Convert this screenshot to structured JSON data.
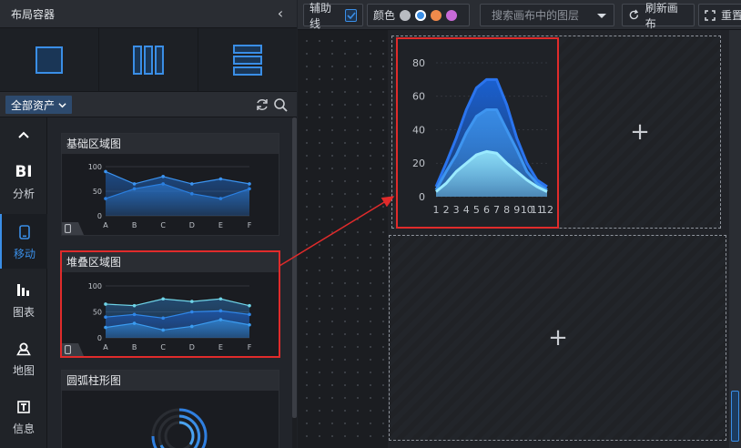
{
  "left_panel": {
    "title": "布局容器",
    "layouts": [
      "single-box-layout",
      "three-column-layout",
      "three-row-layout"
    ],
    "assets_filter": "全部资产"
  },
  "nav": {
    "items": [
      {
        "top": "BI",
        "label": "分析",
        "icon": "bi-text-icon",
        "active": false
      },
      {
        "label": "移动",
        "icon": "mobile-icon",
        "active": true
      },
      {
        "label": "图表",
        "icon": "bar-chart-icon",
        "active": false
      },
      {
        "label": "地图",
        "icon": "map-icon",
        "active": false
      },
      {
        "label": "信息",
        "icon": "text-info-icon",
        "active": false
      }
    ]
  },
  "assets": [
    {
      "title": "基础区域图",
      "selected": false
    },
    {
      "title": "堆叠区域图",
      "selected": true
    },
    {
      "title": "圆弧柱形图",
      "selected": false
    }
  ],
  "toolbar": {
    "guides_label": "辅助线",
    "guides_checked": true,
    "color_label": "颜色",
    "swatches": [
      "#b9bcc2",
      "#3a8ee6",
      "#f08a4b",
      "#c86ad8"
    ],
    "selected_swatch": 1,
    "layer_search_placeholder": "搜索画布中的图层",
    "refresh_label": "刷新画布",
    "reset_label": "重置"
  },
  "colors": {
    "accent": "#3a8ee6",
    "highlight": "#e02b2b"
  },
  "chart_data": [
    {
      "type": "area",
      "title": "基础区域图",
      "categories": [
        "A",
        "B",
        "C",
        "D",
        "E",
        "F"
      ],
      "ylim": [
        0,
        100
      ],
      "yticks": [
        0,
        50,
        100
      ],
      "series": [
        {
          "values": [
            90,
            65,
            80,
            65,
            75,
            65
          ]
        },
        {
          "values": [
            35,
            55,
            65,
            45,
            35,
            55
          ]
        }
      ]
    },
    {
      "type": "area",
      "title": "堆叠区域图",
      "categories": [
        "A",
        "B",
        "C",
        "D",
        "E",
        "F"
      ],
      "ylim": [
        0,
        100
      ],
      "yticks": [
        0,
        50,
        100
      ],
      "series": [
        {
          "values": [
            65,
            62,
            75,
            70,
            75,
            62
          ]
        },
        {
          "values": [
            40,
            45,
            38,
            50,
            52,
            45
          ]
        },
        {
          "values": [
            20,
            28,
            15,
            22,
            35,
            25
          ]
        }
      ]
    },
    {
      "type": "area",
      "categories": [
        "1",
        "2",
        "3",
        "4",
        "5",
        "6",
        "7",
        "8",
        "9",
        "10",
        "11",
        "12"
      ],
      "ylim": [
        0,
        80
      ],
      "yticks": [
        0,
        20,
        40,
        60,
        80
      ],
      "series": [
        {
          "values": [
            6,
            20,
            35,
            52,
            65,
            70,
            70,
            55,
            35,
            20,
            10,
            6
          ]
        },
        {
          "values": [
            4,
            15,
            25,
            38,
            48,
            52,
            52,
            40,
            28,
            15,
            8,
            4
          ]
        },
        {
          "values": [
            3,
            8,
            15,
            20,
            25,
            27,
            26,
            20,
            15,
            10,
            6,
            3
          ]
        }
      ]
    }
  ]
}
